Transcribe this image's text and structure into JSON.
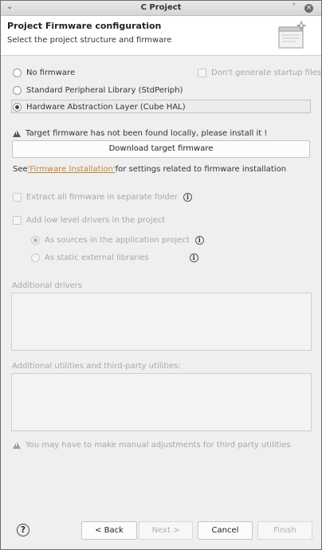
{
  "window": {
    "title": "C Project",
    "menu_glyph": "⌄",
    "minimize_glyph": "˅",
    "close_glyph": "×"
  },
  "header": {
    "title": "Project Firmware configuration",
    "subtitle": "Select the project structure and firmware"
  },
  "options": {
    "no_firmware": "No firmware",
    "std_periph": "Standard Peripheral Library (StdPeriph)",
    "cube_hal": "Hardware Abstraction Layer (Cube HAL)",
    "dont_generate": "Don't generate startup files"
  },
  "firmware": {
    "warning": "Target firmware has not been found locally, please install it !",
    "download_button": "Download target firmware",
    "see_prefix": "See ",
    "link_text": "'Firmware Installation'",
    "see_suffix": " for settings related to firmware installation"
  },
  "extract_all": "Extract all firmware in separate folder",
  "low_level": {
    "label": "Add low level drivers in the project",
    "as_sources": "As sources in the application project",
    "as_static": "As static external libraries"
  },
  "info_glyph": "i",
  "additional_drivers": {
    "label": "Additional drivers"
  },
  "additional_utilities": {
    "label": "Additional utilities and third-party utilities:"
  },
  "third_party_note": "You may have to make manual adjustments for third party utilities",
  "footer": {
    "help_glyph": "?",
    "back": "< Back",
    "next": "Next >",
    "cancel": "Cancel",
    "finish": "Finish"
  }
}
